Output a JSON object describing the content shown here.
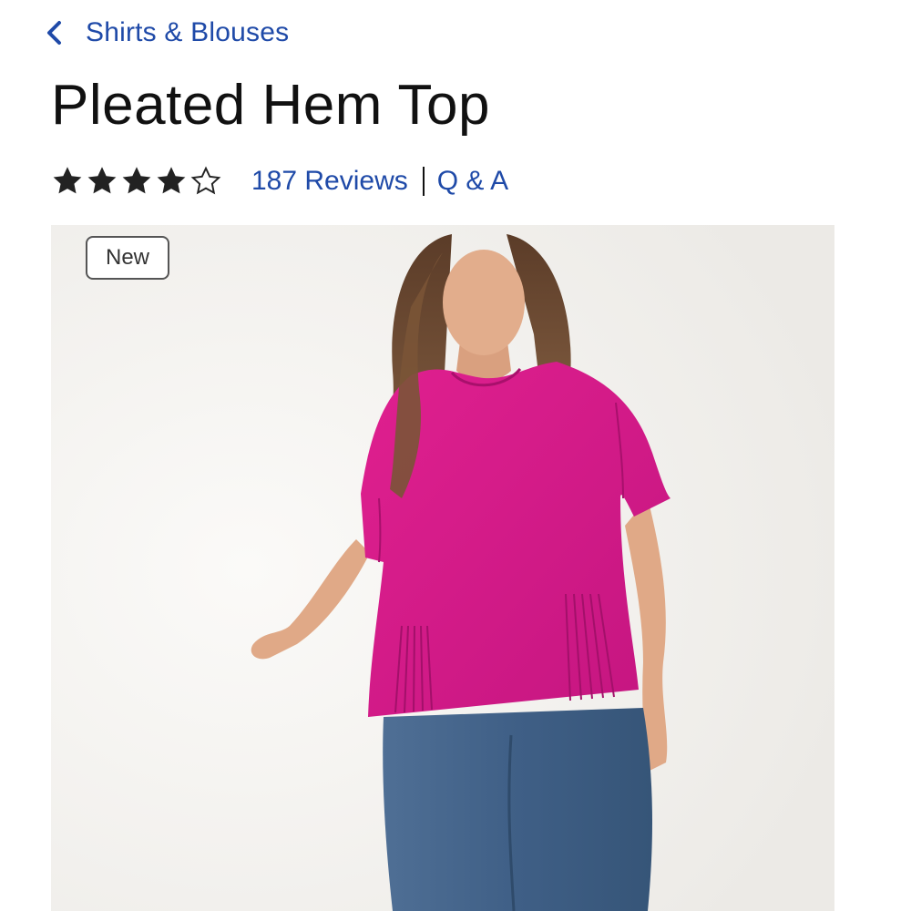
{
  "breadcrumb": {
    "label": "Shirts & Blouses",
    "icon": "chevron-left-icon"
  },
  "product": {
    "title": "Pleated Hem Top"
  },
  "rating": {
    "stars": 4,
    "max": 5,
    "reviews_label": "187 Reviews",
    "qa_label": "Q & A"
  },
  "image": {
    "badge": "New",
    "product_color": "#d81b8c"
  },
  "colors": {
    "link": "#1f4aa8",
    "text": "#111111"
  }
}
